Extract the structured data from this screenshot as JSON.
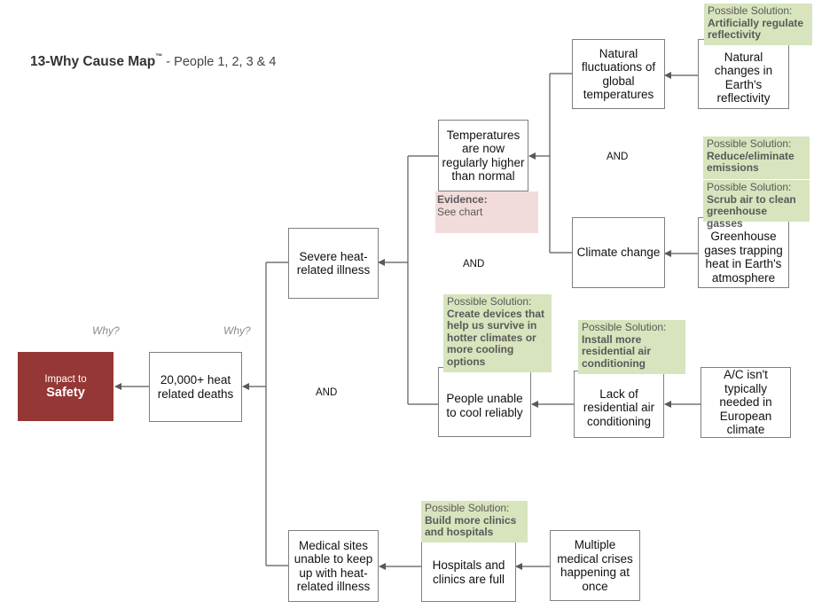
{
  "title": {
    "main": "13-Why Cause Map",
    "trademark": "™",
    "subtitle": " - People 1, 2, 3 & 4"
  },
  "colors": {
    "impact_fill": "#953735",
    "solution_fill": "#d7e4bd",
    "evidence_fill": "#f2dcdb",
    "connector": "#595959"
  },
  "why_labels": [
    "Why?",
    "Why?"
  ],
  "and_labels": [
    "AND",
    "AND",
    "AND"
  ],
  "impact": {
    "line1": "Impact to",
    "line2": "Safety"
  },
  "nodes": {
    "deaths": "20,000+ heat related deaths",
    "severe_illness": "Severe heat-related illness",
    "medical_sites": "Medical sites unable to keep up with heat-related illness",
    "temperatures": "Temperatures are now regularly higher than normal",
    "unable_cool": "People unable to cool reliably",
    "natural_fluct": "Natural fluctuations of global temperatures",
    "climate_change": "Climate change",
    "reflectivity": "Natural changes in Earth's reflectivity",
    "greenhouse": "Greenhouse gases trapping heat in Earth's atmosphere",
    "lack_ac": "Lack of residential air conditioning",
    "ac_not_needed": "A/C isn't typically needed in European climate",
    "hospitals_full": "Hospitals and clinics are full",
    "multiple_crises": "Multiple medical crises happening at once"
  },
  "evidence": {
    "label": "Evidence:",
    "value": "See chart"
  },
  "solutions": {
    "label": "Possible Solution:",
    "reflectivity": "Artificially regulate reflectivity",
    "emissions": "Reduce/eliminate emissions",
    "scrub_air": "Scrub air to clean greenhouse gasses",
    "devices": "Create devices that help us survive in hotter climates or more cooling options",
    "install_ac": "Install more residential air conditioning",
    "build_clinics": "Build more clinics and hospitals"
  }
}
